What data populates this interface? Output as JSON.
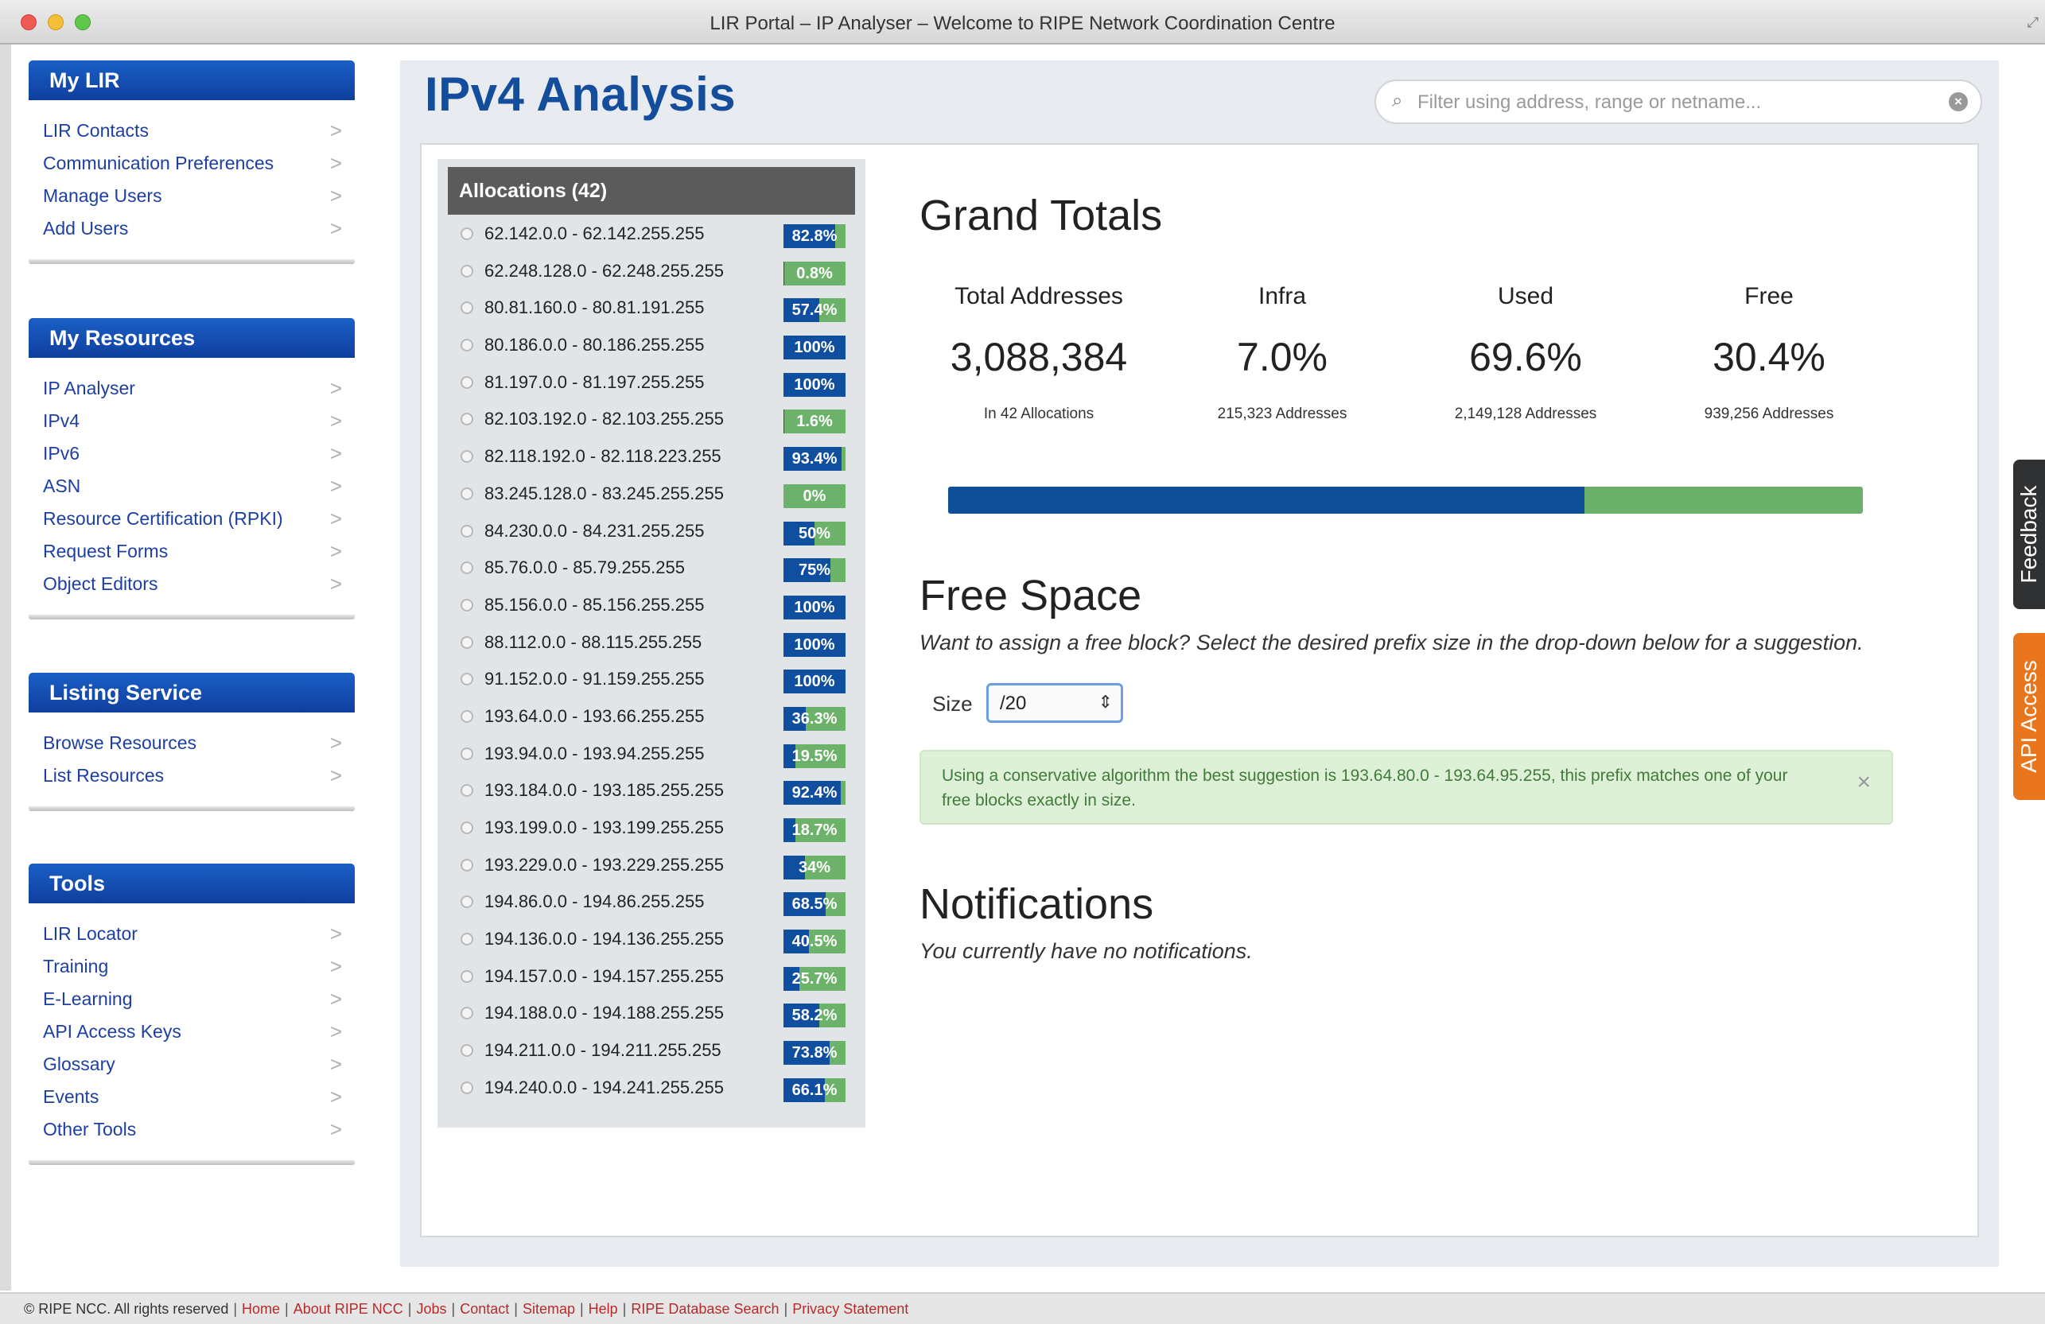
{
  "window": {
    "title": "LIR Portal – IP Analyser – Welcome to RIPE Network Coordination Centre"
  },
  "sidebar": {
    "boxes": [
      {
        "title": "My LIR",
        "items": [
          "LIR Contacts",
          "Communication Preferences",
          "Manage Users",
          "Add Users"
        ]
      },
      {
        "title": "My Resources",
        "items": [
          "IP Analyser",
          "IPv4",
          "IPv6",
          "ASN",
          "Resource Certification (RPKI)",
          "Request Forms",
          "Object Editors"
        ]
      },
      {
        "title": "Listing Service",
        "items": [
          "Browse Resources",
          "List Resources"
        ]
      },
      {
        "title": "Tools",
        "items": [
          "LIR Locator",
          "Training",
          "E-Learning",
          "API Access Keys",
          "Glossary",
          "Events",
          "Other Tools"
        ]
      }
    ],
    "chevron": ">"
  },
  "page": {
    "title": "IPv4 Analysis"
  },
  "search": {
    "placeholder": "Filter using address, range or netname...",
    "value": ""
  },
  "allocations": {
    "header": "Allocations (42)",
    "items": [
      {
        "range": "62.142.0.0 - 62.142.255.255",
        "used": 82.8,
        "label": "82.8%"
      },
      {
        "range": "62.248.128.0 - 62.248.255.255",
        "used": 0.8,
        "label": "0.8%"
      },
      {
        "range": "80.81.160.0 - 80.81.191.255",
        "used": 57.4,
        "label": "57.4%"
      },
      {
        "range": "80.186.0.0 - 80.186.255.255",
        "used": 100,
        "label": "100%"
      },
      {
        "range": "81.197.0.0 - 81.197.255.255",
        "used": 100,
        "label": "100%"
      },
      {
        "range": "82.103.192.0 - 82.103.255.255",
        "used": 1.6,
        "label": "1.6%"
      },
      {
        "range": "82.118.192.0 - 82.118.223.255",
        "used": 93.4,
        "label": "93.4%"
      },
      {
        "range": "83.245.128.0 - 83.245.255.255",
        "used": 0,
        "label": "0%"
      },
      {
        "range": "84.230.0.0 - 84.231.255.255",
        "used": 50,
        "label": "50%"
      },
      {
        "range": "85.76.0.0 - 85.79.255.255",
        "used": 75,
        "label": "75%"
      },
      {
        "range": "85.156.0.0 - 85.156.255.255",
        "used": 100,
        "label": "100%"
      },
      {
        "range": "88.112.0.0 - 88.115.255.255",
        "used": 100,
        "label": "100%"
      },
      {
        "range": "91.152.0.0 - 91.159.255.255",
        "used": 100,
        "label": "100%"
      },
      {
        "range": "193.64.0.0 - 193.66.255.255",
        "used": 36.3,
        "label": "36.3%"
      },
      {
        "range": "193.94.0.0 - 193.94.255.255",
        "used": 19.5,
        "label": "19.5%"
      },
      {
        "range": "193.184.0.0 - 193.185.255.255",
        "used": 92.4,
        "label": "92.4%"
      },
      {
        "range": "193.199.0.0 - 193.199.255.255",
        "used": 18.7,
        "label": "18.7%"
      },
      {
        "range": "193.229.0.0 - 193.229.255.255",
        "used": 34,
        "label": "34%"
      },
      {
        "range": "194.86.0.0 - 194.86.255.255",
        "used": 68.5,
        "label": "68.5%"
      },
      {
        "range": "194.136.0.0 - 194.136.255.255",
        "used": 40.5,
        "label": "40.5%"
      },
      {
        "range": "194.157.0.0 - 194.157.255.255",
        "used": 25.7,
        "label": "25.7%"
      },
      {
        "range": "194.188.0.0 - 194.188.255.255",
        "used": 58.2,
        "label": "58.2%"
      },
      {
        "range": "194.211.0.0 - 194.211.255.255",
        "used": 73.8,
        "label": "73.8%"
      },
      {
        "range": "194.240.0.0 - 194.241.255.255",
        "used": 66.1,
        "label": "66.1%"
      }
    ]
  },
  "grand_totals": {
    "title": "Grand Totals",
    "stats": [
      {
        "label": "Total Addresses",
        "value": "3,088,384",
        "sub": "In 42 Allocations"
      },
      {
        "label": "Infra",
        "value": "7.0%",
        "sub": "215,323 Addresses"
      },
      {
        "label": "Used",
        "value": "69.6%",
        "sub": "2,149,128 Addresses"
      },
      {
        "label": "Free",
        "value": "30.4%",
        "sub": "939,256 Addresses"
      }
    ],
    "used_fraction": 0.696
  },
  "free_space": {
    "title": "Free Space",
    "description": "Want to assign a free block? Select the desired prefix size in the drop-down below for a suggestion.",
    "size_label": "Size",
    "size_value": "/20",
    "suggestion": "Using a conservative algorithm the best suggestion is 193.64.80.0 - 193.64.95.255, this prefix matches one of your free blocks exactly in size.",
    "close": "×"
  },
  "notifications": {
    "title": "Notifications",
    "message": "You currently have no notifications."
  },
  "side_tabs": {
    "feedback": "Feedback",
    "api": "API Access"
  },
  "footer": {
    "copyright": "© RIPE NCC. All rights reserved",
    "links": [
      "Home",
      "About RIPE NCC",
      "Jobs",
      "Contact",
      "Sitemap",
      "Help",
      "RIPE Database Search",
      "Privacy Statement"
    ]
  },
  "colors": {
    "brand_blue": "#134d9b",
    "sidebar_header": "#1a5fc6",
    "used_blue": "#104fa0",
    "free_green": "#6cb26a",
    "alert_green_bg": "#dff0d8",
    "api_orange": "#e9761c"
  }
}
